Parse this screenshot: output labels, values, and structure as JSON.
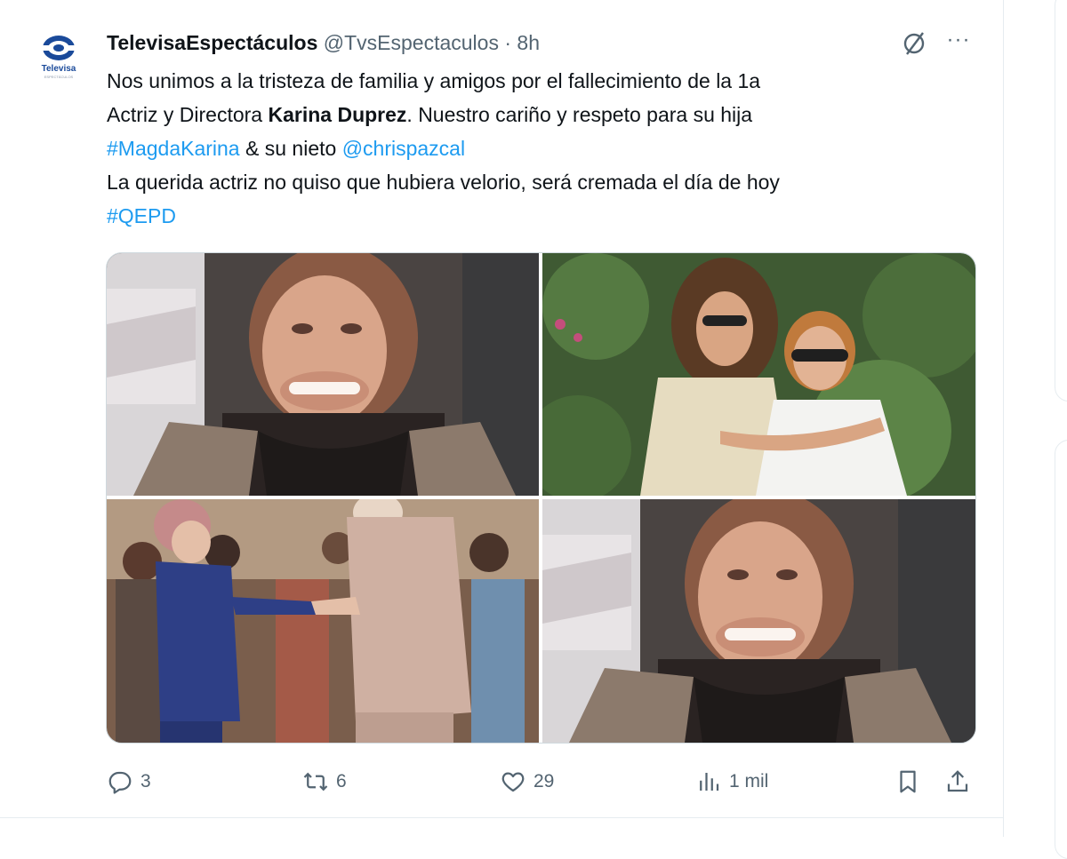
{
  "tweet": {
    "display_name": "TelevisaEspectáculos",
    "handle": "@TvsEspectaculos",
    "separator": "·",
    "time": "8h",
    "avatar_logo_text": "Televisa",
    "avatar_logo_sub": "ESPECTÁCULOS",
    "more_icon": "more-dots-icon",
    "grok_icon": "grok-icon",
    "text": {
      "line1": "Nos unimos a la tristeza de familia y amigos por el fallecimiento de la 1a",
      "line2_pre": "Actriz y Directora ",
      "line2_bold": "Karina Duprez",
      "line2_post": ". Nuestro cariño y respeto para su hija",
      "hashtag1": "#MagdaKarina",
      "line3_mid": " & su nieto ",
      "mention1": "@chrispazcal",
      "line4": "La querida actriz no quiso que hubiera velorio, será cremada el día de hoy",
      "hashtag2": "#QEPD"
    },
    "media": [
      {
        "alt": "photo-1-smiling-woman-closeup"
      },
      {
        "alt": "photo-2-two-women-garden"
      },
      {
        "alt": "photo-3-dancing-couple"
      },
      {
        "alt": "photo-4-smiling-woman-closeup"
      }
    ],
    "actions": {
      "replies": "3",
      "reposts": "6",
      "likes": "29",
      "views": "1 mil"
    },
    "colors": {
      "accent": "#1d9bf0",
      "secondary_text": "#536471",
      "primary_text": "#0f1419",
      "border": "#cfd9de"
    }
  }
}
